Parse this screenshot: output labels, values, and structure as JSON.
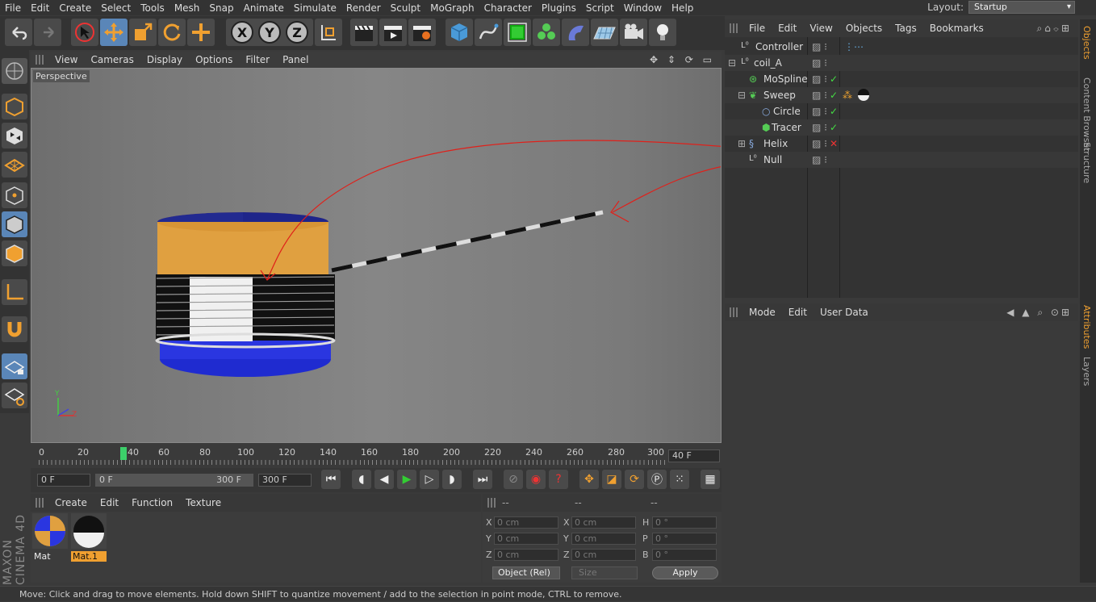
{
  "menu": [
    "File",
    "Edit",
    "Create",
    "Select",
    "Tools",
    "Mesh",
    "Snap",
    "Animate",
    "Simulate",
    "Render",
    "Sculpt",
    "MoGraph",
    "Character",
    "Plugins",
    "Script",
    "Window",
    "Help"
  ],
  "layout": {
    "label": "Layout:",
    "value": "Startup"
  },
  "toolbar": {
    "x_label": "X",
    "y_label": "Y",
    "z_label": "Z"
  },
  "viewport": {
    "menu": [
      "View",
      "Cameras",
      "Display",
      "Options",
      "Filter",
      "Panel"
    ],
    "camera_label": "Perspective",
    "axis": {
      "y": "Y",
      "z": "Z"
    }
  },
  "timeline": {
    "ticks": [
      "0",
      "20",
      "40",
      "60",
      "80",
      "100",
      "120",
      "140",
      "160",
      "180",
      "200",
      "220",
      "240",
      "260",
      "280",
      "300"
    ],
    "current_frame": "40 F"
  },
  "playback": {
    "frame_field": "0 F",
    "range_start": "0 F",
    "range_end": "300 F",
    "end_field": "300 F"
  },
  "materials": {
    "menu": [
      "Create",
      "Edit",
      "Function",
      "Texture"
    ],
    "items": [
      {
        "name": "Mat"
      },
      {
        "name": "Mat.1"
      }
    ]
  },
  "coords": {
    "headers": [
      "--",
      "--",
      "--"
    ],
    "rows": [
      {
        "a": "X",
        "av": "0 cm",
        "b": "X",
        "bv": "0 cm",
        "c": "H",
        "cv": "0 °"
      },
      {
        "a": "Y",
        "av": "0 cm",
        "b": "Y",
        "bv": "0 cm",
        "c": "P",
        "cv": "0 °"
      },
      {
        "a": "Z",
        "av": "0 cm",
        "b": "Z",
        "bv": "0 cm",
        "c": "B",
        "cv": "0 °"
      }
    ],
    "mode": "Object (Rel)",
    "size": "Size",
    "apply": "Apply"
  },
  "objects": {
    "menu": [
      "File",
      "Edit",
      "View",
      "Objects",
      "Tags",
      "Bookmarks"
    ],
    "items": [
      {
        "name": "Controller",
        "status": ""
      },
      {
        "name": "coil_A",
        "status": ""
      },
      {
        "name": "MoSpline",
        "status": "check"
      },
      {
        "name": "Sweep",
        "status": "check"
      },
      {
        "name": "Circle",
        "status": "check"
      },
      {
        "name": "Tracer",
        "status": "check"
      },
      {
        "name": "Helix",
        "status": "cross"
      },
      {
        "name": "Null",
        "status": ""
      }
    ]
  },
  "attributes": {
    "menu": [
      "Mode",
      "Edit",
      "User Data"
    ]
  },
  "side_tabs": [
    "Objects",
    "Content Browser",
    "Structure",
    "Attributes",
    "Layers"
  ],
  "brand": "MAXON CINEMA 4D",
  "status_text": "Move: Click and drag to move elements. Hold down SHIFT to quantize movement / add to the selection in point mode, CTRL to remove.",
  "colors": {
    "accent": "#5a86b8",
    "orange": "#e8a030",
    "viewport_bg": "#808080"
  }
}
